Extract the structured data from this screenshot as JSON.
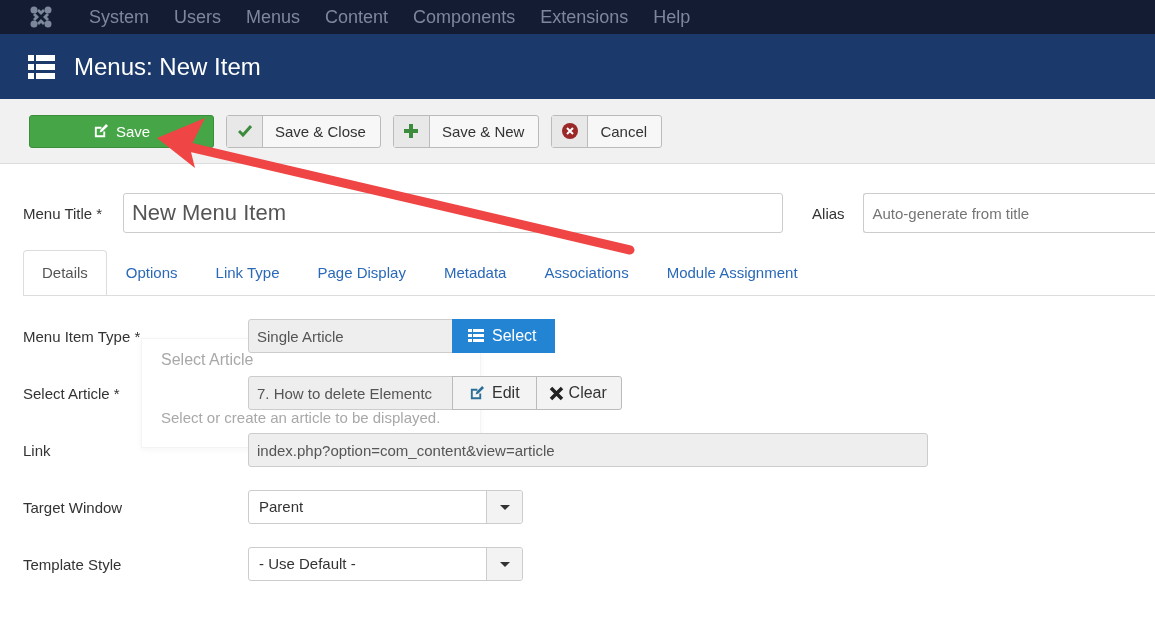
{
  "navbar": {
    "items": [
      {
        "label": "System"
      },
      {
        "label": "Users"
      },
      {
        "label": "Menus"
      },
      {
        "label": "Content"
      },
      {
        "label": "Components"
      },
      {
        "label": "Extensions"
      },
      {
        "label": "Help"
      }
    ]
  },
  "header": {
    "title": "Menus: New Item"
  },
  "toolbar": {
    "buttons": [
      {
        "label": "Save",
        "kind": "primary"
      },
      {
        "label": "Save & Close",
        "kind": "default"
      },
      {
        "label": "Save & New",
        "kind": "default"
      },
      {
        "label": "Cancel",
        "kind": "default"
      }
    ]
  },
  "title_field": {
    "label": "Menu Title *",
    "value": "New Menu Item"
  },
  "alias_field": {
    "label": "Alias",
    "placeholder": "Auto-generate from title"
  },
  "tabs": [
    {
      "label": "Details",
      "selected": true
    },
    {
      "label": "Options",
      "selected": false
    },
    {
      "label": "Link Type",
      "selected": false
    },
    {
      "label": "Page Display",
      "selected": false
    },
    {
      "label": "Metadata",
      "selected": false
    },
    {
      "label": "Associations",
      "selected": false
    },
    {
      "label": "Module Assignment",
      "selected": false
    }
  ],
  "fields": [
    {
      "label": "Menu Item Type *",
      "kind": "input-button",
      "value": "Single Article",
      "buttons": [
        {
          "label": "Select",
          "kind": "primary"
        }
      ]
    },
    {
      "label": "Select Article *",
      "kind": "input-button",
      "value": "7. How to delete Elementc",
      "buttons": [
        {
          "label": "Edit",
          "kind": "default"
        },
        {
          "label": "Clear",
          "kind": "default"
        }
      ]
    },
    {
      "label": "Link",
      "kind": "readonly",
      "value": "index.php?option=com_content&view=article"
    },
    {
      "label": "Target Window",
      "kind": "select",
      "value": "Parent"
    },
    {
      "label": "Template Style",
      "kind": "select",
      "value": "- Use Default -"
    }
  ],
  "tooltip": {
    "title": "Select Article",
    "text": "Select or create an article to be displayed."
  }
}
